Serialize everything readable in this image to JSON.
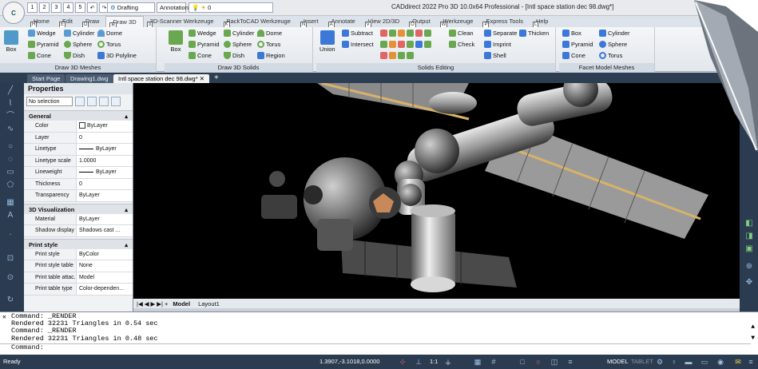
{
  "window": {
    "title": "CADdirect 2022 Pro 3D 10.0x64 Professional - [Intl space station dec 98.dwg*]",
    "app_button": "C",
    "workspace": "Drafting",
    "annotation": "Annotation"
  },
  "ribbon_tabs": [
    {
      "label": "Home",
      "key": "H"
    },
    {
      "label": "Edit",
      "key": "E"
    },
    {
      "label": "Draw",
      "key": "D"
    },
    {
      "label": "Draw 3D",
      "key": "R"
    },
    {
      "label": "3D-Scanner Werkzeuge",
      "key": "3"
    },
    {
      "label": "BackToCAD Werkzeuge",
      "key": "K"
    },
    {
      "label": "Insert",
      "key": "N"
    },
    {
      "label": "Annotate",
      "key": "A"
    },
    {
      "label": "View 2D/3D",
      "key": "V"
    },
    {
      "label": "Output",
      "key": "O"
    },
    {
      "label": "Werkzeuge",
      "key": "W"
    },
    {
      "label": "Express Tools",
      "key": "P"
    },
    {
      "label": "Help",
      "key": "L"
    }
  ],
  "panels": {
    "draw3dmeshes": {
      "title": "Draw 3D Meshes",
      "box": "Box",
      "wedge": "Wedge",
      "cylinder": "Cylinder",
      "dome": "Dome",
      "pyramid": "Pyramid",
      "sphere": "Sphere",
      "torus": "Torus",
      "cone": "Cone",
      "dish": "Dish",
      "polyline": "3D Polyline"
    },
    "draw3dsolids": {
      "title": "Draw 3D Solids",
      "box": "Box",
      "wedge": "Wedge",
      "cylinder": "Cylinder",
      "dome": "Dome",
      "pyramid": "Pyramid",
      "sphere": "Sphere",
      "torus": "Torus",
      "cone": "Cone",
      "dish": "Dish",
      "region": "Region"
    },
    "solidsediting": {
      "title": "Solids Editing",
      "union": "Union",
      "subtract": "Subtract",
      "intersect": "Intersect",
      "clean": "Clean",
      "check": "Check",
      "separate": "Separate",
      "imprint": "Imprint",
      "shell": "Shell",
      "thicken": "Thicken"
    },
    "facetmodel": {
      "title": "Facet Model Meshes",
      "box": "Box",
      "cylinder": "Cylinder",
      "pyramid": "Pyramid",
      "sphere": "Sphere",
      "cone": "Cone",
      "torus": "Torus"
    }
  },
  "doc_tabs": [
    "Start Page",
    "Drawing1.dwg",
    "Intl space station dec 98.dwg*"
  ],
  "properties": {
    "title": "Properties",
    "selection": "No selection",
    "sections": [
      {
        "name": "General",
        "rows": [
          [
            "Color",
            "ByLayer"
          ],
          [
            "Layer",
            "0"
          ],
          [
            "Linetype",
            "ByLayer"
          ],
          [
            "Linetype scale",
            "1.0000"
          ],
          [
            "Lineweight",
            "ByLayer"
          ],
          [
            "Thickness",
            "0"
          ],
          [
            "Transparency",
            "ByLayer"
          ]
        ]
      },
      {
        "name": "3D Visualization",
        "rows": [
          [
            "Material",
            "ByLayer"
          ],
          [
            "Shadow display",
            "Shadows cast ..."
          ]
        ]
      },
      {
        "name": "Print style",
        "rows": [
          [
            "Print style",
            "ByColor"
          ],
          [
            "Print style table",
            "None"
          ],
          [
            "Print table attac...",
            "Model"
          ],
          [
            "Print table type",
            "Color-dependen..."
          ]
        ]
      }
    ]
  },
  "layout_tabs": [
    "Model",
    "Layout1"
  ],
  "command_history": [
    "Command: _RENDER",
    "Rendered 32231 Triangles in 0.54 sec",
    "Command: _RENDER",
    "Rendered 32231 Triangles in 0.48 sec"
  ],
  "command_prompt": "Command:",
  "status": {
    "ready": "Ready",
    "coords": "1.3907,-3.1018,0.0000",
    "scale": "1:1",
    "model": "MODEL",
    "tablet": "TABLET"
  }
}
